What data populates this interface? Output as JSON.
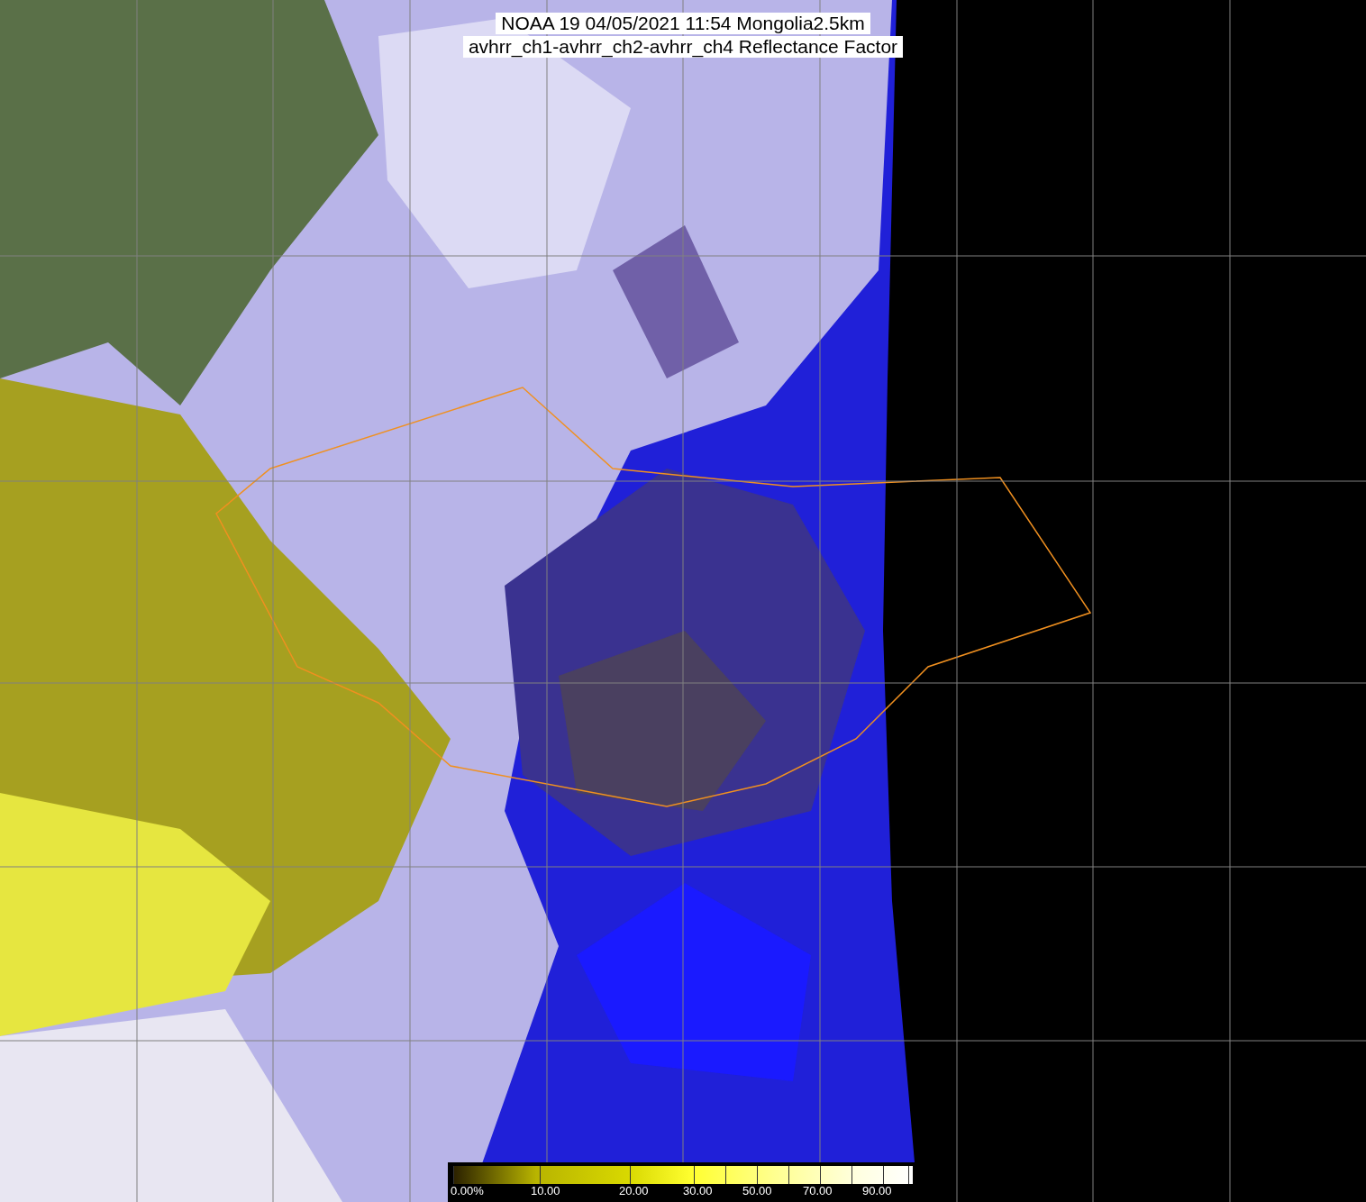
{
  "title": {
    "lines": [
      "NOAA 19 04/05/2021 11:54 Mongolia2.5km",
      "avhrr_ch1-avhrr_ch2-avhrr_ch4 Reflectance Factor"
    ]
  },
  "colorbar": {
    "labels": [
      "0.00%",
      "10.00",
      "20.00",
      "30.00",
      "50.00",
      "70.00",
      "90.00"
    ]
  }
}
